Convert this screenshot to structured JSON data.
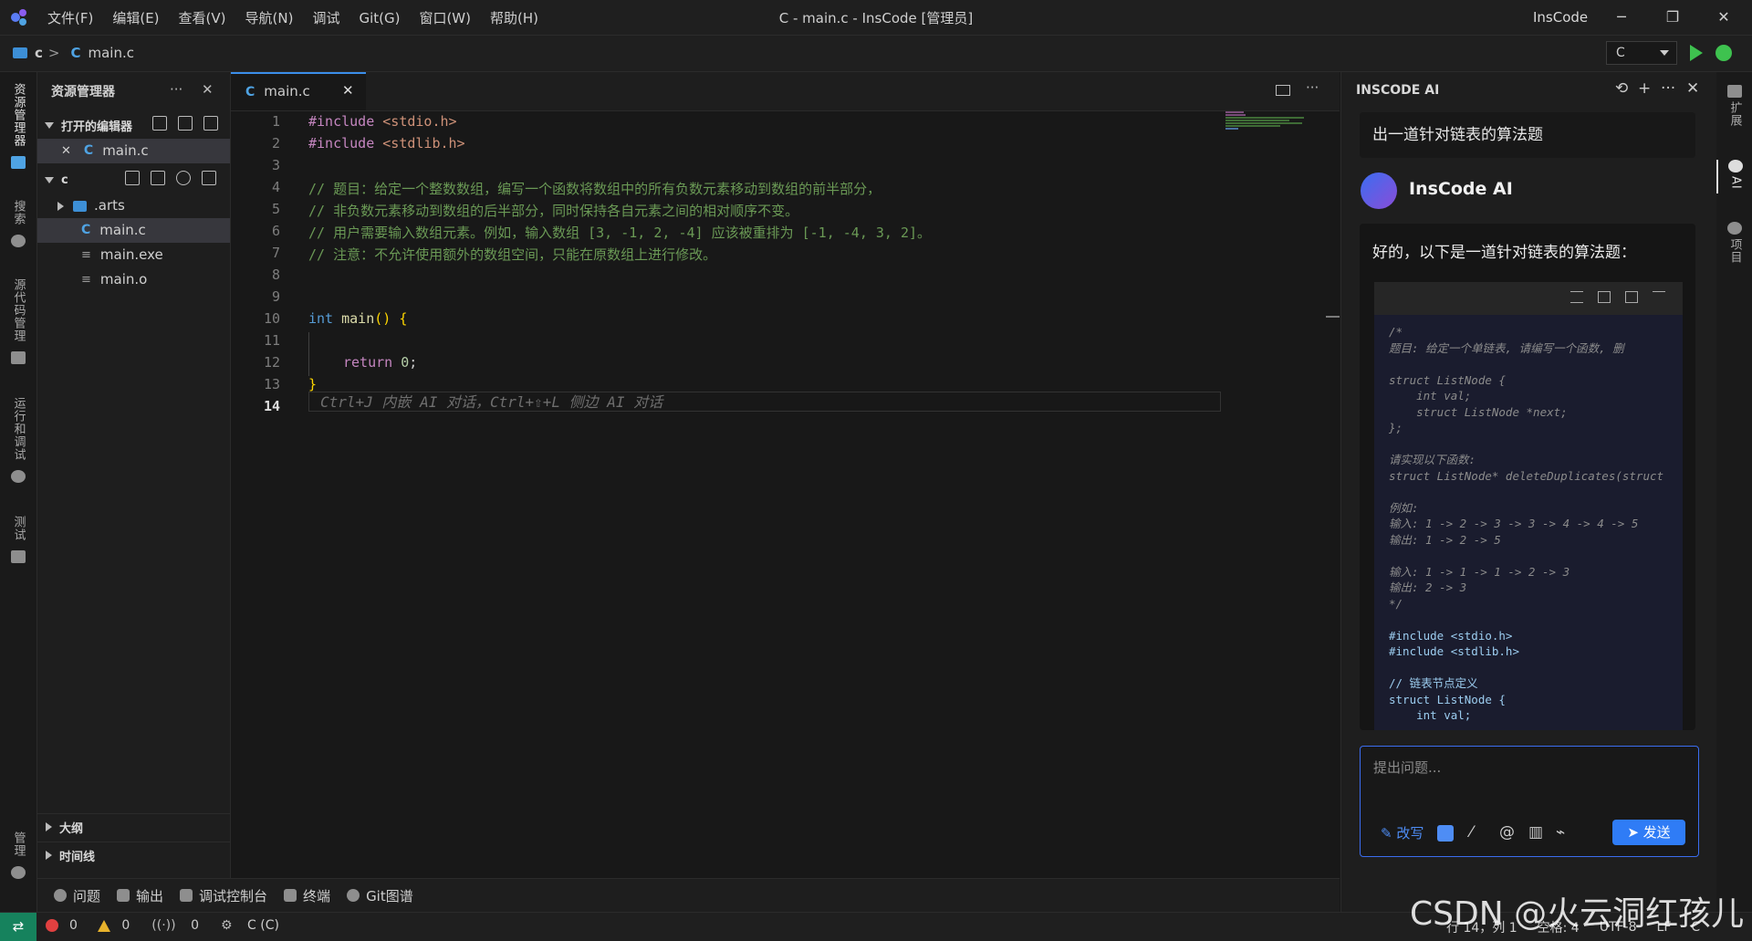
{
  "titlebar": {
    "menu": [
      "文件(F)",
      "编辑(E)",
      "查看(V)",
      "导航(N)",
      "调试",
      "Git(G)",
      "窗口(W)",
      "帮助(H)"
    ],
    "window_title": "C - main.c - InsCode [管理员]",
    "brand": "InsCode",
    "minimize": "─",
    "maximize": "❐",
    "close": "✕"
  },
  "toolbar": {
    "breadcrumb_root": "c",
    "breadcrumb_sep": ">",
    "breadcrumb_file_icon": "C",
    "breadcrumb_file": "main.c",
    "language": "C"
  },
  "activity_bar": {
    "items": [
      "资源管理器",
      "搜索",
      "源代码管理",
      "运行和调试",
      "测试",
      "管理"
    ]
  },
  "explorer": {
    "title": "资源管理器",
    "more": "···",
    "close": "✕",
    "open_editors_label": "打开的编辑器",
    "open_editor_close": "✕",
    "open_editor_icon": "C",
    "open_editor_file": "main.c",
    "folder_label": "c",
    "tree": [
      {
        "name": ".arts",
        "icon": "folder-icon"
      },
      {
        "name": "main.c",
        "icon": "C"
      },
      {
        "name": "main.exe",
        "icon": "≡"
      },
      {
        "name": "main.o",
        "icon": "≡"
      }
    ],
    "outline_label": "大纲",
    "timeline_label": "时间线"
  },
  "editor": {
    "tab_icon": "C",
    "tab_label": "main.c",
    "tab_close": "✕",
    "line_numbers": [
      "1",
      "2",
      "3",
      "4",
      "5",
      "6",
      "7",
      "8",
      "9",
      "10",
      "11",
      "12",
      "13",
      "14"
    ],
    "current_line": "14",
    "lines": {
      "l1_inc": "#include ",
      "l1_hdr": "<stdio.h>",
      "l2_inc": "#include ",
      "l2_hdr": "<stdlib.h>",
      "l4": "// 题目：给定一个整数数组，编写一个函数将数组中的所有负数元素移动到数组的前半部分，",
      "l5": "// 非负数元素移动到数组的后半部分，同时保持各自元素之间的相对顺序不变。",
      "l6": "// 用户需要输入数组元素。例如，输入数组 [3, -1, 2, -4] 应该被重排为 [-1, -4, 3, 2]。",
      "l7": "// 注意：不允许使用额外的数组空间，只能在原数组上进行修改。",
      "l10_kw": "int",
      "l10_fn": "main",
      "l10_rest": "() {",
      "l12_kw": "return",
      "l12_num": "0",
      "l12_semi": ";",
      "l13": "}"
    },
    "ghost_hint": "Ctrl+J 内嵌 AI 对话，Ctrl+⇧+L 侧边 AI 对话"
  },
  "ai_panel": {
    "title": "INSCODE AI",
    "user_message": "出一道针对链表的算法题",
    "assistant_name": "InsCode AI",
    "answer_intro": "好的，以下是一道针对链表的算法题：",
    "code_lines": [
      "/*",
      "题目: 给定一个单链表, 请编写一个函数, 删",
      "",
      "struct ListNode {",
      "    int val;",
      "    struct ListNode *next;",
      "};",
      "",
      "请实现以下函数:",
      "struct ListNode* deleteDuplicates(struct",
      "",
      "例如:",
      "输入: 1 -> 2 -> 3 -> 3 -> 4 -> 4 -> 5",
      "输出: 1 -> 2 -> 5",
      "",
      "输入: 1 -> 1 -> 1 -> 2 -> 3",
      "输出: 2 -> 3",
      "*/",
      "",
      "#include <stdio.h>",
      "#include <stdlib.h>",
      "",
      "// 链表节点定义",
      "struct ListNode {",
      "    int val;"
    ],
    "input_placeholder": "提出问题...",
    "rewrite_label": "✎ 改写",
    "send_label": "➤ 发送"
  },
  "right_bar": {
    "items": [
      "扩展",
      "AI",
      "项目"
    ]
  },
  "panel_tabs": [
    "问题",
    "输出",
    "调试控制台",
    "终端",
    "Git图谱"
  ],
  "status": {
    "remote_icon": "⇄",
    "errors": "0",
    "warnings": "0",
    "broadcast": "0",
    "language_env": "C (C)",
    "cursor": "行 14，列 1",
    "spaces": "空格: 4",
    "encoding": "UTF-8",
    "eol": "LF",
    "lang": "C"
  },
  "watermark": "CSDN @火云洞红孩儿",
  "colors": {
    "accent": "#3b8eea",
    "run_green": "#3ec24f",
    "send_blue": "#2f7cf6",
    "remote_green": "#16825d"
  }
}
